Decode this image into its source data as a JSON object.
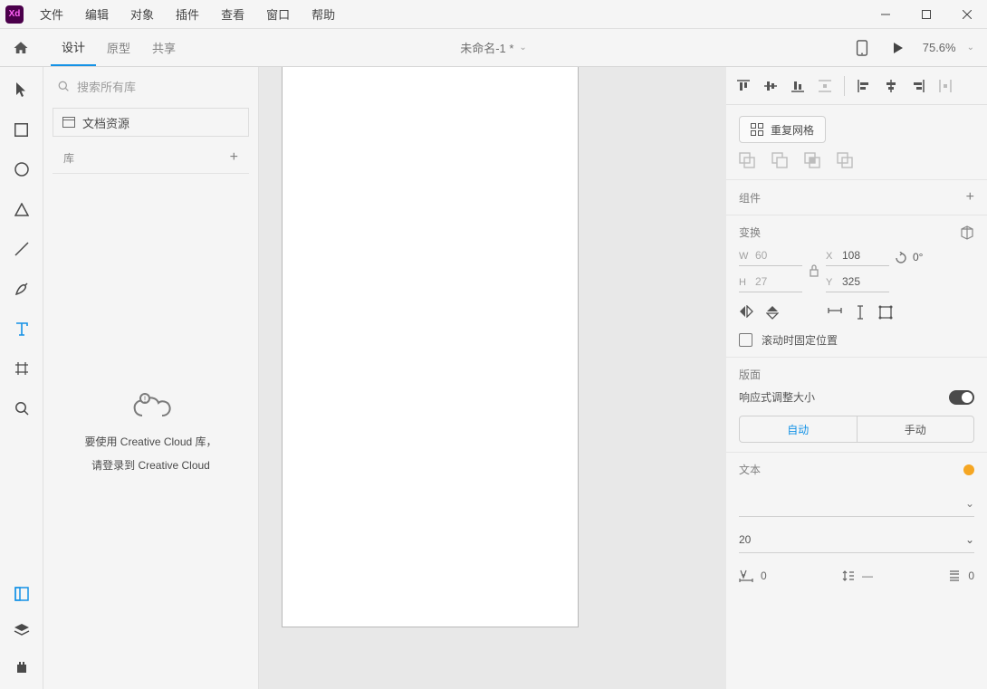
{
  "menu": {
    "items": [
      "文件",
      "编辑",
      "对象",
      "插件",
      "查看",
      "窗口",
      "帮助"
    ]
  },
  "modes": {
    "design": "设计",
    "prototype": "原型",
    "share": "共享"
  },
  "document": {
    "title": "未命名-1 *"
  },
  "zoom": {
    "value": "75.6%"
  },
  "left": {
    "search_placeholder": "搜索所有库",
    "doc_assets": "文档资源",
    "lib_label": "库",
    "cc_line1": "要使用 Creative Cloud 库，",
    "cc_line2": "请登录到 Creative Cloud"
  },
  "right": {
    "repeat_grid": "重复网格",
    "component": "组件",
    "transform": "变换",
    "w": "60",
    "h": "27",
    "x": "108",
    "y": "325",
    "rotation": "0°",
    "fix_scroll": "滚动时固定位置",
    "layout": "版面",
    "responsive": "响应式调整大小",
    "auto": "自动",
    "manual": "手动",
    "text": "文本",
    "font_size": "20",
    "char_spacing": "0",
    "line_dash": "—",
    "para_spacing": "0"
  }
}
